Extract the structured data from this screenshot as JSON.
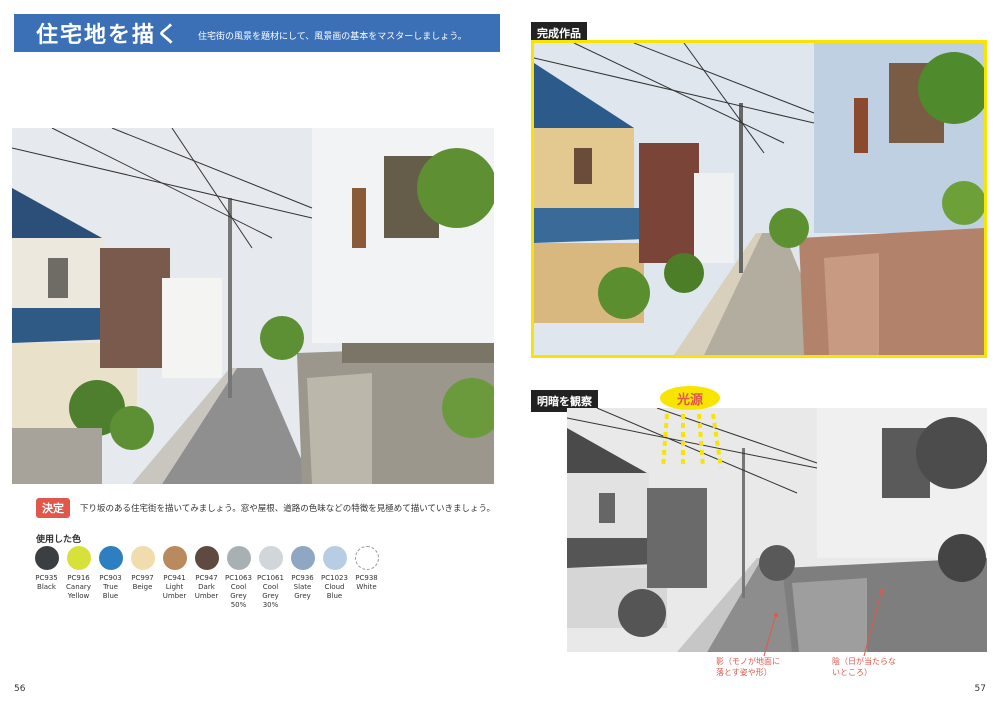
{
  "left_page": {
    "title": "住宅地を描く",
    "subtitle": "住宅街の風景を題材にして、風景画の基本をマスターしましょう。",
    "decision_badge": "決定",
    "decision_text": "下り坂のある住宅街を描いてみましょう。窓や屋根、道路の色味などの特徴を見極めて描いていきましょう。",
    "colors_heading": "使用した色",
    "pencils": [
      {
        "code": "PC935",
        "name": "Black",
        "color": "#3c3f42"
      },
      {
        "code": "PC916",
        "name": "Canary\nYellow",
        "color": "#d6e23a"
      },
      {
        "code": "PC903",
        "name": "True\nBlue",
        "color": "#2d7fc1"
      },
      {
        "code": "PC997",
        "name": "Beige",
        "color": "#f1dcae"
      },
      {
        "code": "PC941",
        "name": "Light\nUmber",
        "color": "#b98a5e"
      },
      {
        "code": "PC947",
        "name": "Dark\nUmber",
        "color": "#5e4a41"
      },
      {
        "code": "PC1063",
        "name": "Cool\nGrey\n50%",
        "color": "#a8b0b4"
      },
      {
        "code": "PC1061",
        "name": "Cool\nGrey\n30%",
        "color": "#d0d6da"
      },
      {
        "code": "PC936",
        "name": "Slate\nGrey",
        "color": "#8fa7c3"
      },
      {
        "code": "PC1023",
        "name": "Cloud\nBlue",
        "color": "#b8cde3"
      },
      {
        "code": "PC938",
        "name": "White",
        "color": "#ffffff"
      }
    ],
    "page_number": "56"
  },
  "right_page": {
    "finished_label": "完成作品",
    "light_label": "明暗を観察",
    "light_source": "光源",
    "note_shadow": "影（モノが地面に\n落とす姿や形）",
    "note_shade": "陰（日が当たらな\nいところ）",
    "page_number": "57"
  },
  "colors": {
    "banner_blue": "#3b6fb6",
    "accent_red": "#e2574c",
    "frame_yellow": "#f7e500"
  }
}
